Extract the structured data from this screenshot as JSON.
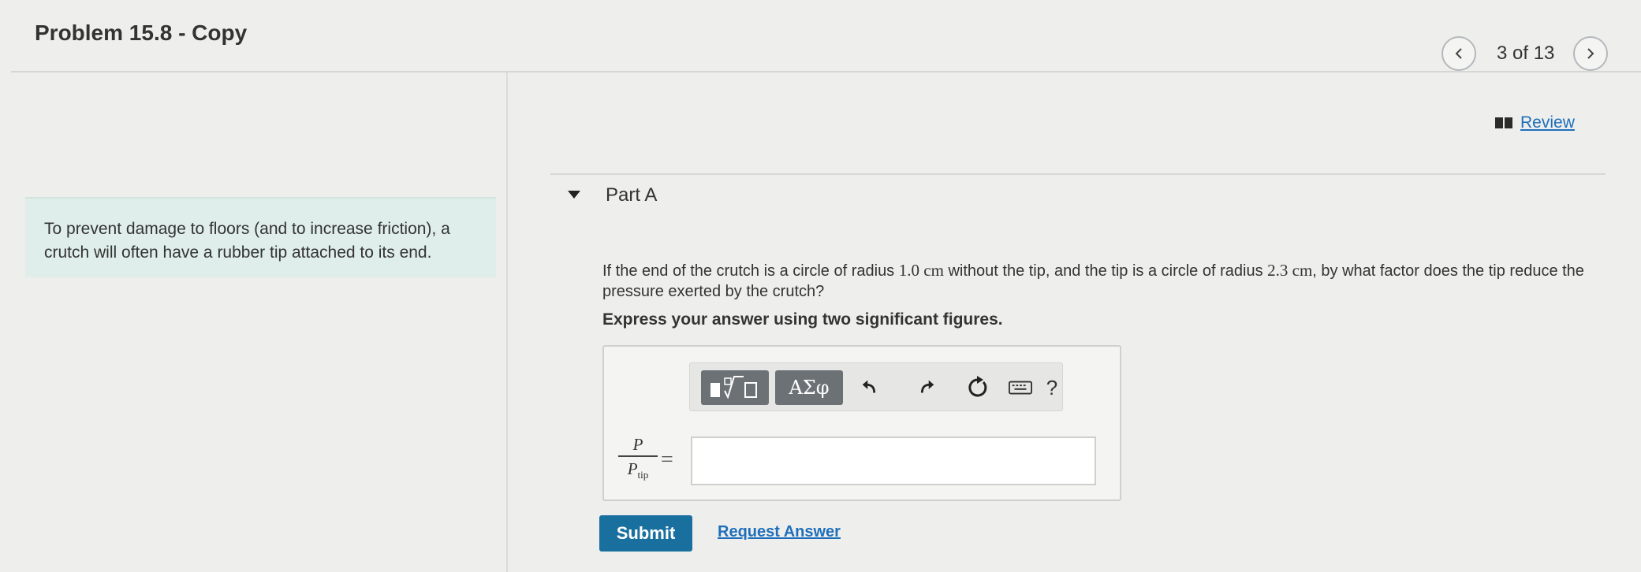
{
  "header": {
    "title": "Problem 15.8 - Copy",
    "pager": {
      "text": "3 of 13"
    }
  },
  "intro": {
    "text": "To prevent damage to floors (and to increase friction), a crutch will often have a rubber tip attached to its end."
  },
  "review": {
    "label": "Review"
  },
  "part": {
    "title": "Part A",
    "question_before_r1": "If the end of the crutch is a circle of radius ",
    "r1": "1.0 cm",
    "question_mid": " without the tip, and the tip is a circle of radius ",
    "r2": "2.3 cm",
    "question_after": ", by what factor does the tip reduce the pressure exerted by the crutch?",
    "instruction": "Express your answer using two significant figures."
  },
  "answer": {
    "toolbar": {
      "symbols_label": "ΑΣφ",
      "help_label": "?"
    },
    "lhs_numerator": "P",
    "lhs_denominator": "P",
    "lhs_denominator_sub": "tip",
    "equals": "=",
    "input_value": ""
  },
  "actions": {
    "submit_label": "Submit",
    "request_label": "Request Answer"
  },
  "colors": {
    "accent": "#19709f",
    "link": "#1e6fbb",
    "intro_bg": "#dfeeea",
    "toolbar_btn": "#6c7176"
  }
}
